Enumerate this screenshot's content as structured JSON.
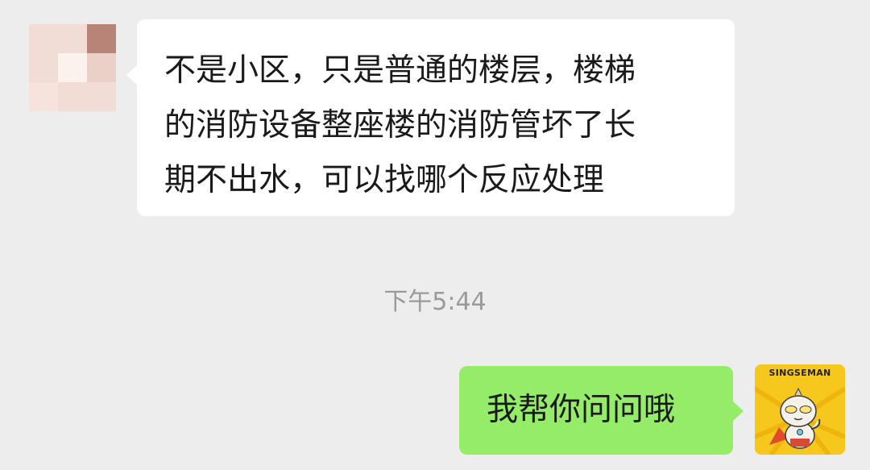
{
  "chat": {
    "incoming_message": {
      "lines": [
        "不是小区，只是普通的楼层，楼梯",
        "的消防设备整座楼的消防管坏了长",
        "期不出水，可以找哪个反应处理"
      ]
    },
    "timestamp": "下午5:44",
    "outgoing_message": {
      "text": "我帮你问问哦"
    },
    "sender_avatar": {
      "style": "pixelated-mosaic",
      "colors": [
        "#f1ddd6",
        "#b98478",
        "#fbf2ee"
      ]
    },
    "own_avatar": {
      "label": "SINGSEMAN",
      "icon": "cartoon-hero-sticker",
      "background": "#f6c71c"
    }
  },
  "colors": {
    "background": "#ededed",
    "incoming_bubble": "#ffffff",
    "outgoing_bubble": "#95ec69",
    "timestamp_text": "#9a9a9a"
  }
}
